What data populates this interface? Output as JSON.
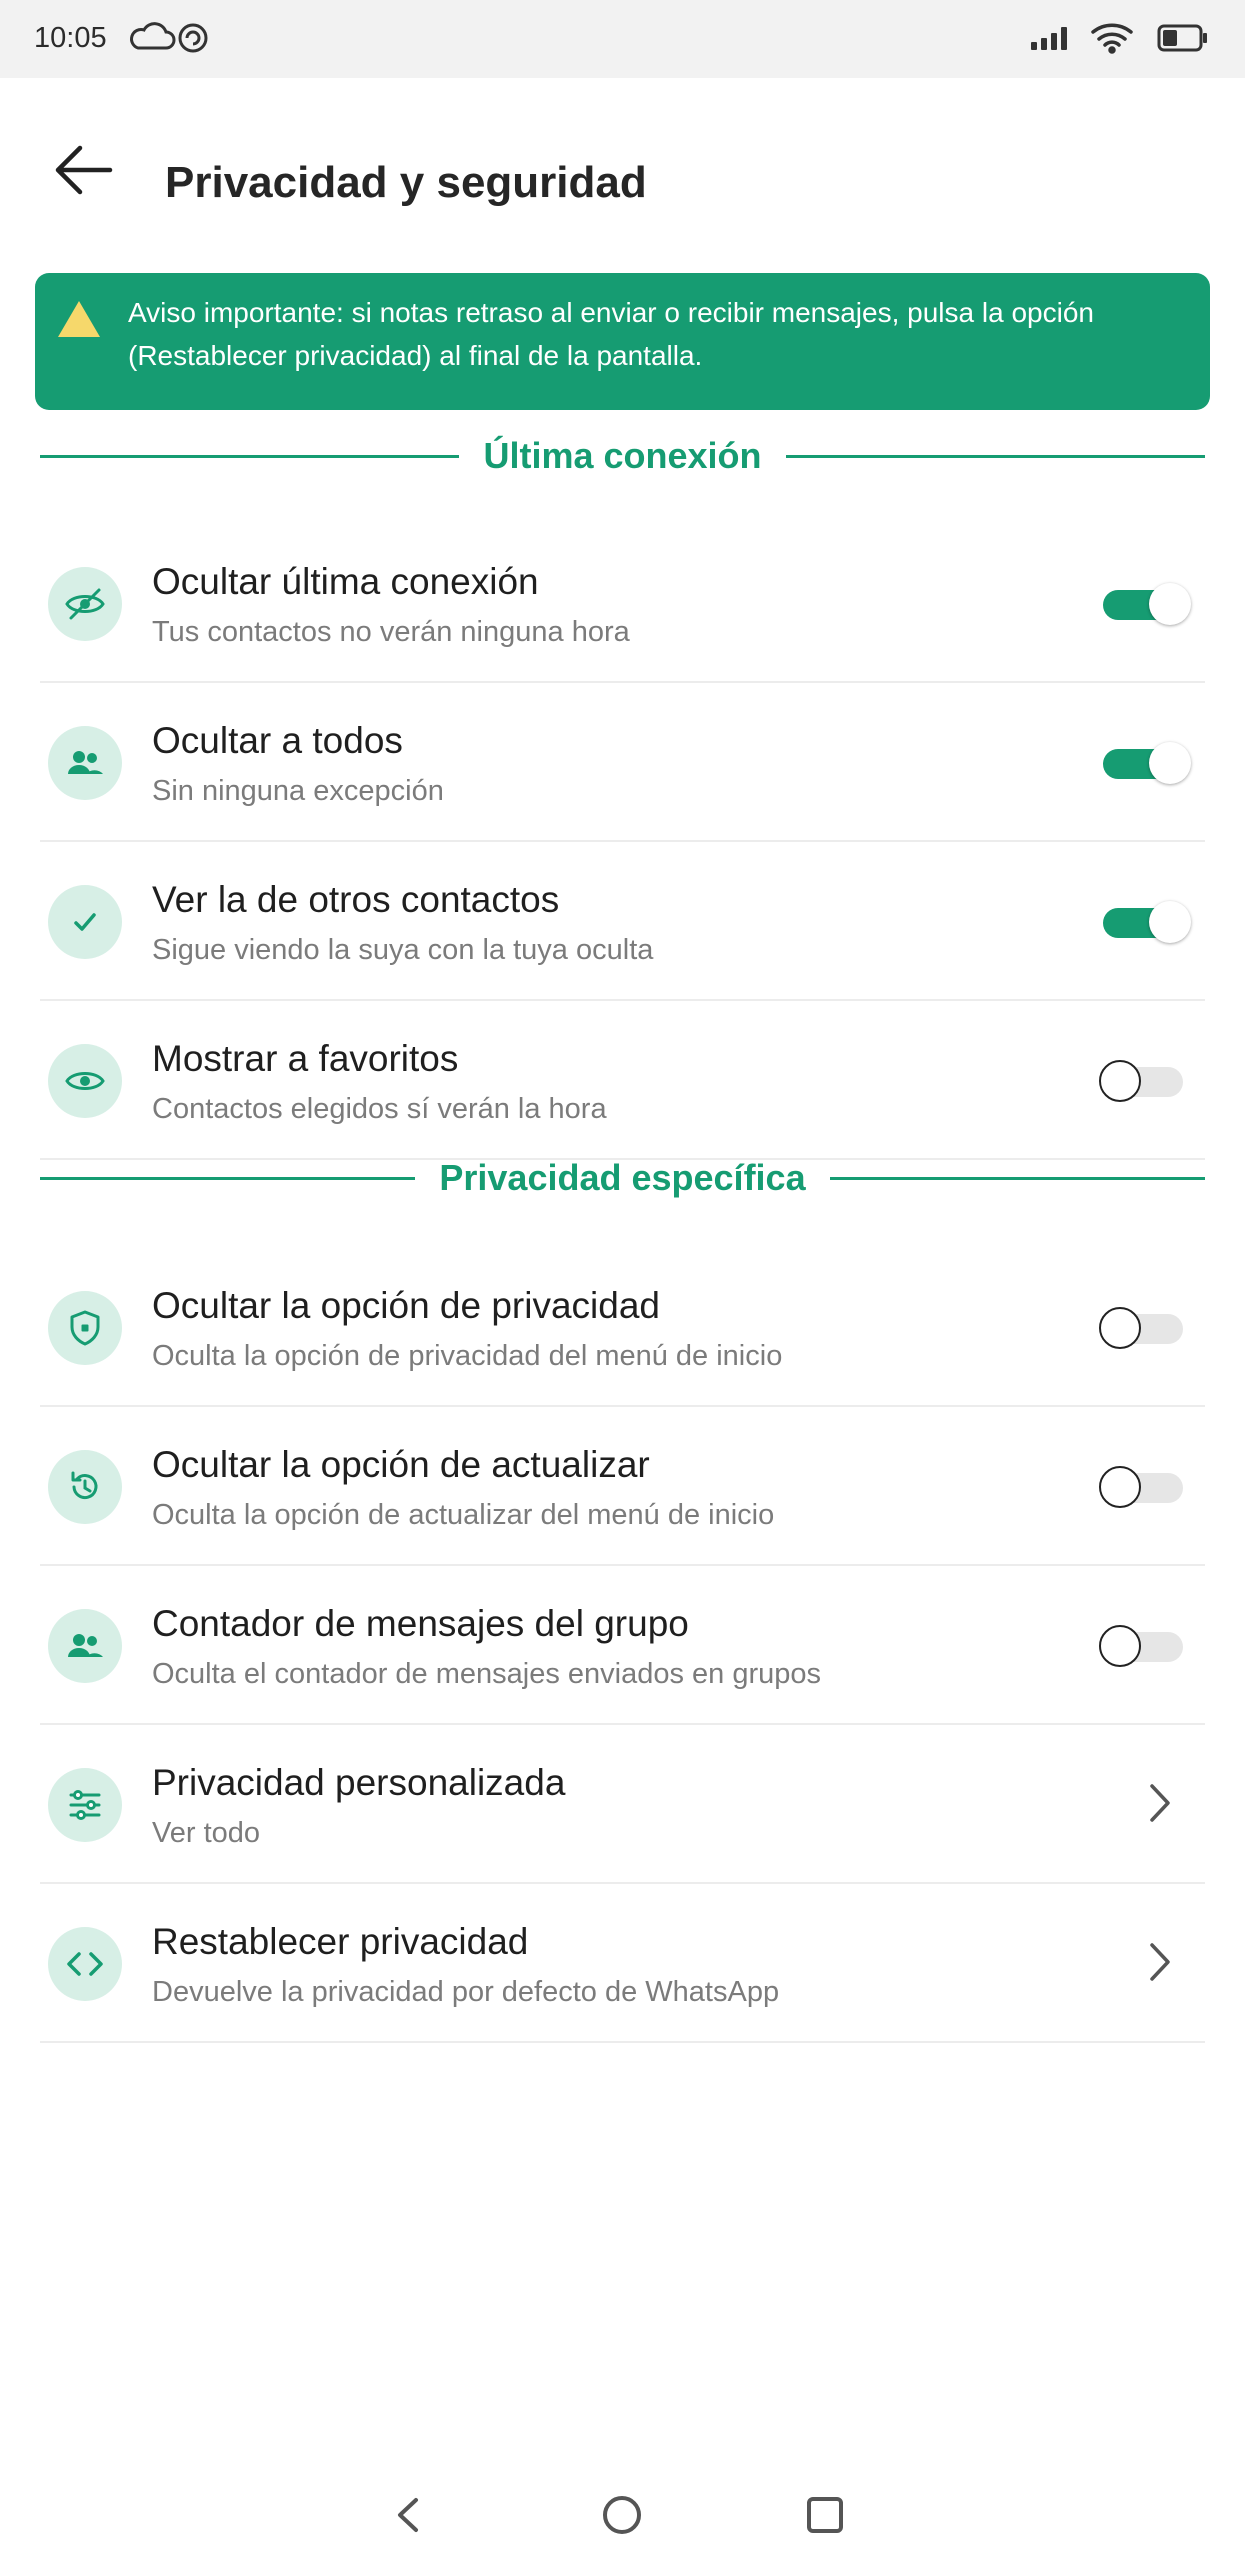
{
  "status": {
    "time": "10:05",
    "left_icons": [
      "cloud-icon",
      "sync-icon"
    ],
    "right_icons": [
      "signal-icon",
      "wifi-icon",
      "battery-icon"
    ]
  },
  "header": {
    "back_icon": "arrow-left-icon",
    "title": "Privacidad y seguridad"
  },
  "notice": {
    "icon": "warning-icon",
    "text": "Aviso importante: si notas retraso al enviar o recibir mensajes, pulsa la opción (Restablecer privacidad) al final de la pantalla."
  },
  "sections": [
    {
      "title": "Última conexión",
      "items": [
        {
          "icon": "eye-off-icon",
          "title": "Ocultar última conexión",
          "subtitle": "Tus contactos no verán ninguna hora",
          "control": "toggle",
          "on": true
        },
        {
          "icon": "group-icon",
          "title": "Ocultar a todos",
          "subtitle": "Sin ninguna excepción",
          "control": "toggle",
          "on": true
        },
        {
          "icon": "check-icon",
          "title": "Ver la de otros contactos",
          "subtitle": "Sigue viendo la suya con la tuya oculta",
          "control": "toggle",
          "on": true
        },
        {
          "icon": "eye-icon",
          "title": "Mostrar a favoritos",
          "subtitle": "Contactos elegidos sí verán la hora",
          "control": "toggle",
          "on": false
        }
      ]
    },
    {
      "title": "Privacidad específica",
      "items": [
        {
          "icon": "shield-icon",
          "title": "Ocultar la opción de privacidad",
          "subtitle": "Oculta la opción de privacidad del menú de inicio",
          "control": "toggle",
          "on": false
        },
        {
          "icon": "history-icon",
          "title": "Ocultar la opción de actualizar",
          "subtitle": "Oculta la opción de actualizar del menú de inicio",
          "control": "toggle",
          "on": false
        },
        {
          "icon": "group-icon",
          "title": "Contador de mensajes del grupo",
          "subtitle": "Oculta el contador de mensajes enviados en grupos",
          "control": "toggle",
          "on": false
        },
        {
          "icon": "sliders-icon",
          "title": "Privacidad personalizada",
          "subtitle": "Ver todo",
          "control": "chevron"
        },
        {
          "icon": "code-icon",
          "title": "Restablecer privacidad",
          "subtitle": "Devuelve la privacidad por defecto de WhatsApp",
          "control": "chevron"
        }
      ]
    }
  ],
  "colors": {
    "accent": "#169c72",
    "icon_bg": "#d7efe6",
    "warning": "#f6d86b"
  },
  "navbar": [
    "back-nav-icon",
    "home-nav-icon",
    "recents-nav-icon"
  ]
}
